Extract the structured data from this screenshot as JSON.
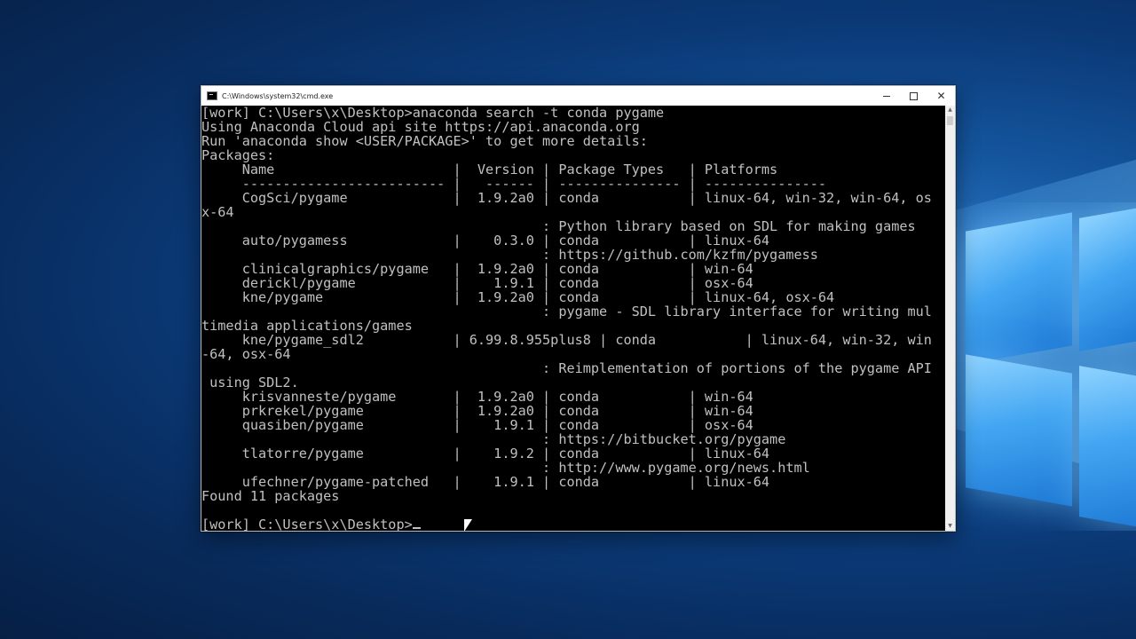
{
  "window": {
    "title": "C:\\Windows\\system32\\cmd.exe",
    "controls": {
      "minimize": "–",
      "maximize": "",
      "close": "✕"
    }
  },
  "console": {
    "lines": [
      "[work] C:\\Users\\x\\Desktop>anaconda search -t conda pygame",
      "Using Anaconda Cloud api site https://api.anaconda.org",
      "Run 'anaconda show <USER/PACKAGE>' to get more details:",
      "Packages:",
      "     Name                      |  Version | Package Types   | Platforms",
      "     ------------------------- |   ------ | --------------- | ---------------",
      "     CogSci/pygame             |  1.9.2a0 | conda           | linux-64, win-32, win-64, os",
      "x-64",
      "                                          : Python library based on SDL for making games",
      "     auto/pygamess             |    0.3.0 | conda           | linux-64",
      "                                          : https://github.com/kzfm/pygamess",
      "     clinicalgraphics/pygame   |  1.9.2a0 | conda           | win-64",
      "     derickl/pygame            |    1.9.1 | conda           | osx-64",
      "     kne/pygame                |  1.9.2a0 | conda           | linux-64, osx-64",
      "                                          : pygame - SDL library interface for writing mul",
      "timedia applications/games",
      "     kne/pygame_sdl2           | 6.99.8.955plus8 | conda           | linux-64, win-32, win",
      "-64, osx-64",
      "                                          : Reimplementation of portions of the pygame API",
      " using SDL2.",
      "     krisvanneste/pygame       |  1.9.2a0 | conda           | win-64",
      "     prkrekel/pygame           |  1.9.2a0 | conda           | win-64",
      "     quasiben/pygame           |    1.9.1 | conda           | osx-64",
      "                                          : https://bitbucket.org/pygame",
      "     tlatorre/pygame           |    1.9.2 | conda           | linux-64",
      "                                          : http://www.pygame.org/news.html",
      "     ufechner/pygame-patched   |    1.9.1 | conda           | linux-64",
      "Found 11 packages",
      ""
    ],
    "prompt": "[work] C:\\Users\\x\\Desktop>"
  },
  "scrollbar": {
    "up_arrow": "▲",
    "down_arrow": "▼"
  },
  "colors": {
    "console_bg": "#000000",
    "console_fg": "#c0c0c0",
    "titlebar_bg": "#ffffff"
  }
}
